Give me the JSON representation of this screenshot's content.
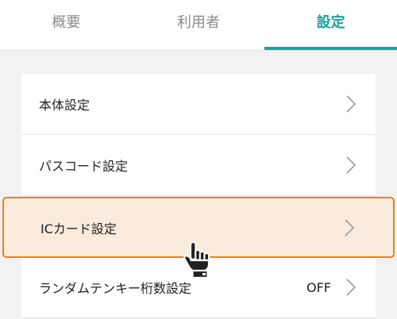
{
  "tabs": [
    {
      "label": "概要",
      "active": false
    },
    {
      "label": "利用者",
      "active": false
    },
    {
      "label": "設定",
      "active": true
    }
  ],
  "settings": {
    "items": [
      {
        "label": "本体設定",
        "value": ""
      },
      {
        "label": "パスコード設定",
        "value": ""
      },
      {
        "label": "ICカード設定",
        "value": "",
        "highlighted": true
      },
      {
        "label": "ランダムテンキー桁数設定",
        "value": "OFF"
      }
    ]
  },
  "colors": {
    "accent": "#1aa3a3",
    "highlight_border": "#ee7e1d",
    "highlight_fill": "#fde8d6",
    "background": "#f2f2f2"
  },
  "icons": {
    "chevron": "chevron-right-icon",
    "pointer": "hand-pointer-icon"
  }
}
